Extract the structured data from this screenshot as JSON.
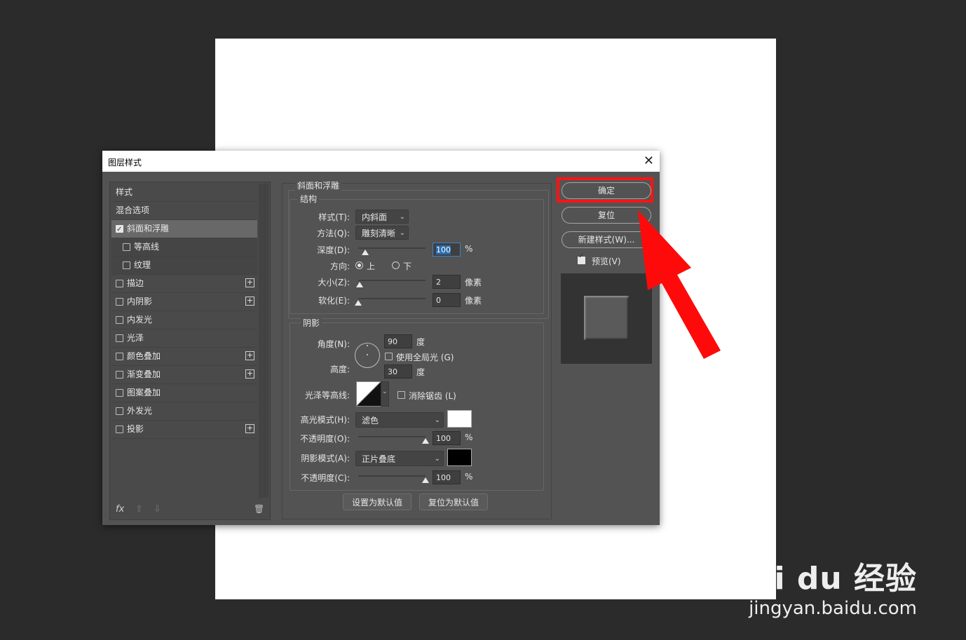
{
  "dialog": {
    "title": "图层样式"
  },
  "left_panel": {
    "items": [
      {
        "label": "样式",
        "type": "header"
      },
      {
        "label": "混合选项",
        "type": "header"
      },
      {
        "label": "斜面和浮雕",
        "checked": true,
        "selected": true
      },
      {
        "label": "等高线",
        "checked": false,
        "sub": true
      },
      {
        "label": "纹理",
        "checked": false,
        "sub": true
      },
      {
        "label": "描边",
        "checked": false,
        "plus": true
      },
      {
        "label": "内阴影",
        "checked": false,
        "plus": true
      },
      {
        "label": "内发光",
        "checked": false
      },
      {
        "label": "光泽",
        "checked": false
      },
      {
        "label": "颜色叠加",
        "checked": false,
        "plus": true
      },
      {
        "label": "渐变叠加",
        "checked": false,
        "plus": true
      },
      {
        "label": "图案叠加",
        "checked": false
      },
      {
        "label": "外发光",
        "checked": false
      },
      {
        "label": "投影",
        "checked": false,
        "plus": true
      }
    ],
    "footer": {
      "fx": "fx",
      "up": "⇧",
      "down": "⇩",
      "trash": "🗑"
    }
  },
  "bevel": {
    "group_title": "斜面和浮雕",
    "structure_title": "结构",
    "style_label": "样式(T):",
    "style_value": "内斜面",
    "method_label": "方法(Q):",
    "method_value": "雕刻清晰",
    "depth_label": "深度(D):",
    "depth_value": "100",
    "depth_unit": "%",
    "depth_level": 0.1,
    "direction_label": "方向:",
    "dir_up": "上",
    "dir_down": "下",
    "direction_selected": "上",
    "size_label": "大小(Z):",
    "size_value": "2",
    "size_unit": "像素",
    "size_level": 0.02,
    "soften_label": "软化(E):",
    "soften_value": "0",
    "soften_unit": "像素",
    "soften_level": 0
  },
  "shading": {
    "title": "阴影",
    "angle_label": "角度(N):",
    "angle_value": "90",
    "angle_unit": "度",
    "global_light_label": "使用全局光 (G)",
    "global_light_checked": false,
    "altitude_label": "高度:",
    "altitude_value": "30",
    "altitude_unit": "度",
    "gloss_label": "光泽等高线:",
    "antialias_label": "消除锯齿 (L)",
    "antialias_checked": false,
    "highlight_mode_label": "高光模式(H):",
    "highlight_mode_value": "滤色",
    "highlight_color": "#ffffff",
    "highlight_opacity_label": "不透明度(O):",
    "highlight_opacity_value": "100",
    "highlight_opacity_unit": "%",
    "highlight_opacity_level": 1,
    "shadow_mode_label": "阴影模式(A):",
    "shadow_mode_value": "正片叠底",
    "shadow_color": "#000000",
    "shadow_opacity_label": "不透明度(C):",
    "shadow_opacity_value": "100",
    "shadow_opacity_unit": "%",
    "shadow_opacity_level": 1
  },
  "bottom_buttons": {
    "set_default": "设置为默认值",
    "reset_default": "复位为默认值"
  },
  "right": {
    "ok": "确定",
    "reset": "复位",
    "new_style": "新建样式(W)...",
    "preview_label": "预览(V)",
    "preview_checked": true,
    "highlight_color": "#ff1414"
  },
  "watermark": {
    "logo": "Bai du 经验",
    "url": "jingyan.baidu.com"
  },
  "colors": {
    "canvas": "#ffffff",
    "workspace": "#2b2b2b",
    "dialog": "#535353",
    "arrow": "#ff0a0a"
  }
}
